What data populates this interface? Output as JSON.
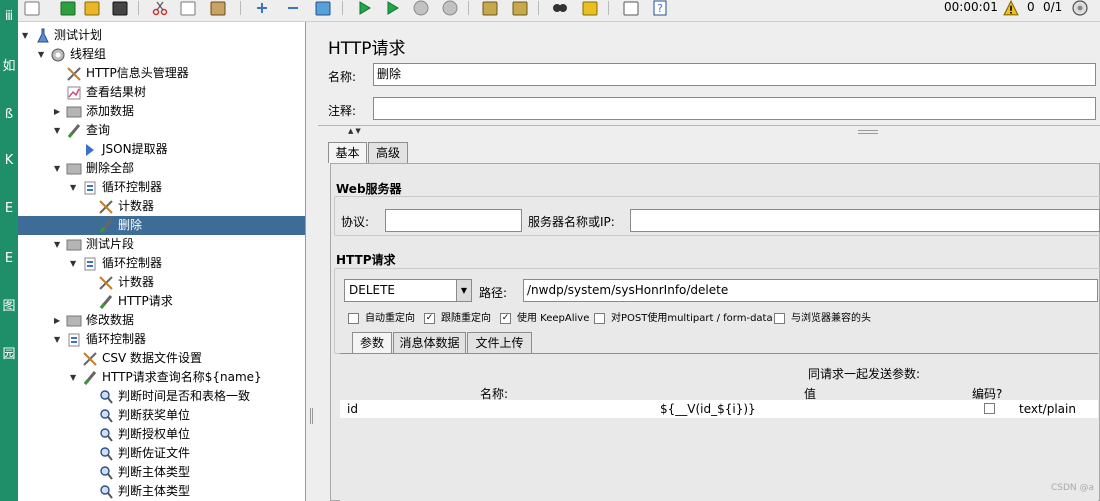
{
  "toolbar": {
    "buttons": [
      {
        "name": "new-icon"
      },
      {
        "name": "templates-icon"
      },
      {
        "name": "open-icon"
      },
      {
        "name": "save-icon"
      },
      {
        "name": "cut-icon"
      },
      {
        "name": "copy-icon"
      },
      {
        "name": "paste-icon"
      },
      {
        "name": "expand-icon"
      },
      {
        "name": "collapse-icon"
      },
      {
        "name": "toggle-icon"
      },
      {
        "name": "start-icon"
      },
      {
        "name": "start-no-pauses-icon"
      },
      {
        "name": "stop-icon"
      },
      {
        "name": "shutdown-icon"
      },
      {
        "name": "clear-icon"
      },
      {
        "name": "clear-all-icon"
      },
      {
        "name": "search-icon"
      },
      {
        "name": "reset-search-icon"
      },
      {
        "name": "function-helper-icon"
      },
      {
        "name": "help-icon"
      }
    ],
    "elapsed_time": "00:00:01",
    "warning_count": "0",
    "threads_ratio": "0/1"
  },
  "left_strip": {
    "glyphs": [
      "ⅲ",
      "如",
      "ß",
      "K",
      "E",
      "Е",
      "图",
      "园"
    ]
  },
  "tree": {
    "items": [
      {
        "label": "测试计划",
        "level": 0,
        "toggle": "▼",
        "icon": "test-plan-icon",
        "selected": false
      },
      {
        "label": "线程组",
        "level": 1,
        "toggle": "▼",
        "icon": "thread-group-icon",
        "selected": false
      },
      {
        "label": "HTTP信息头管理器",
        "level": 2,
        "toggle": "",
        "icon": "header-manager-icon",
        "selected": false
      },
      {
        "label": "查看结果树",
        "level": 2,
        "toggle": "",
        "icon": "results-tree-icon",
        "selected": false
      },
      {
        "label": "添加数据",
        "level": 2,
        "toggle": "▶",
        "icon": "transaction-icon",
        "selected": false
      },
      {
        "label": "查询",
        "level": 2,
        "toggle": "▼",
        "icon": "sampler-icon",
        "selected": false
      },
      {
        "label": "JSON提取器",
        "level": 3,
        "toggle": "",
        "icon": "json-extractor-icon",
        "selected": false
      },
      {
        "label": "删除全部",
        "level": 2,
        "toggle": "▼",
        "icon": "transaction-icon",
        "selected": false
      },
      {
        "label": "循环控制器",
        "level": 3,
        "toggle": "▼",
        "icon": "loop-controller-icon",
        "selected": false
      },
      {
        "label": "计数器",
        "level": 4,
        "toggle": "",
        "icon": "counter-icon",
        "selected": false
      },
      {
        "label": "删除",
        "level": 4,
        "toggle": "",
        "icon": "sampler-icon",
        "selected": true
      },
      {
        "label": "测试片段",
        "level": 2,
        "toggle": "▼",
        "icon": "transaction-icon",
        "selected": false
      },
      {
        "label": "循环控制器",
        "level": 3,
        "toggle": "▼",
        "icon": "loop-controller-icon",
        "selected": false
      },
      {
        "label": "计数器",
        "level": 4,
        "toggle": "",
        "icon": "counter-icon",
        "selected": false
      },
      {
        "label": "HTTP请求",
        "level": 4,
        "toggle": "",
        "icon": "sampler-icon",
        "selected": false
      },
      {
        "label": "修改数据",
        "level": 2,
        "toggle": "▶",
        "icon": "transaction-icon",
        "selected": false
      },
      {
        "label": "循环控制器",
        "level": 2,
        "toggle": "▼",
        "icon": "loop-controller-icon",
        "selected": false
      },
      {
        "label": "CSV 数据文件设置",
        "level": 3,
        "toggle": "",
        "icon": "csv-config-icon",
        "selected": false
      },
      {
        "label": "HTTP请求查询名称${name}",
        "level": 3,
        "toggle": "▼",
        "icon": "sampler-icon",
        "selected": false
      },
      {
        "label": "判断时间是否和表格一致",
        "level": 4,
        "toggle": "",
        "icon": "assertion-icon",
        "selected": false
      },
      {
        "label": "判断获奖单位",
        "level": 4,
        "toggle": "",
        "icon": "assertion-icon",
        "selected": false
      },
      {
        "label": "判断授权单位",
        "level": 4,
        "toggle": "",
        "icon": "assertion-icon",
        "selected": false
      },
      {
        "label": "判断佐证文件",
        "level": 4,
        "toggle": "",
        "icon": "assertion-icon",
        "selected": false
      },
      {
        "label": "判断主体类型",
        "level": 4,
        "toggle": "",
        "icon": "assertion-icon",
        "selected": false
      },
      {
        "label": "判断主体类型",
        "level": 4,
        "toggle": "",
        "icon": "assertion-icon",
        "selected": false
      }
    ]
  },
  "panel": {
    "title": "HTTP请求",
    "name_label": "名称:",
    "name_value": "删除",
    "comment_label": "注释:",
    "comment_value": "",
    "tabs": [
      "基本",
      "高级"
    ],
    "web_server_title": "Web服务器",
    "protocol_label": "协议:",
    "protocol_value": "",
    "server_label": "服务器名称或IP:",
    "server_value": "",
    "http_request_title": "HTTP请求",
    "method_value": "DELETE",
    "path_label": "路径:",
    "path_value": "/nwdp/system/sysHonrInfo/delete",
    "checkboxes": [
      {
        "label": "自动重定向",
        "checked": false
      },
      {
        "label": "跟随重定向",
        "checked": true
      },
      {
        "label": "使用 KeepAlive",
        "checked": true
      },
      {
        "label": "对POST使用multipart / form-data",
        "checked": false
      },
      {
        "label": "与浏览器兼容的头",
        "checked": false
      }
    ],
    "param_tabs": [
      "参数",
      "消息体数据",
      "文件上传"
    ],
    "params_caption": "同请求一起发送参数:",
    "col_name": "名称:",
    "col_value": "值",
    "col_encode": "编码?",
    "row": {
      "name": "id",
      "value": "${__V(id_${i})}",
      "encode_checked": false,
      "content_type": "text/plain"
    }
  },
  "watermark": "CSDN @a"
}
